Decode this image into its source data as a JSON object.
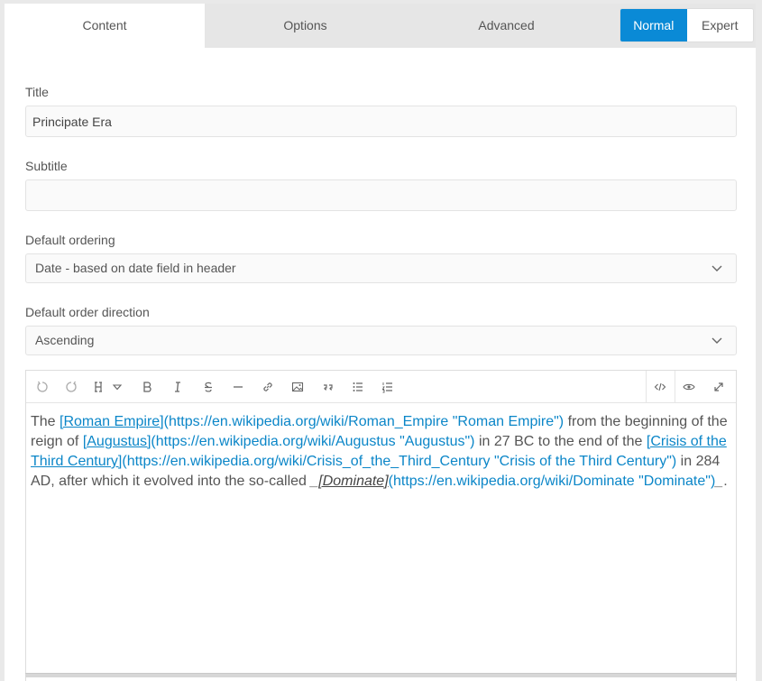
{
  "tabs": [
    {
      "label": "Content"
    },
    {
      "label": "Options"
    },
    {
      "label": "Advanced"
    }
  ],
  "mode": {
    "normal": "Normal",
    "expert": "Expert"
  },
  "fields": {
    "title": {
      "label": "Title",
      "value": "Principate Era"
    },
    "subtitle": {
      "label": "Subtitle",
      "value": ""
    },
    "ordering": {
      "label": "Default ordering",
      "value": "Date - based on date field in header"
    },
    "direction": {
      "label": "Default order direction",
      "value": "Ascending"
    }
  },
  "editor": {
    "toolbar": [
      "undo-icon",
      "redo-icon",
      "heading-icon",
      "bold-icon",
      "italic-icon",
      "strikethrough-icon",
      "horizontal-rule-icon",
      "link-icon",
      "image-icon",
      "quote-icon",
      "bullet-list-icon",
      "numbered-list-icon",
      "code-view-icon",
      "preview-icon",
      "fullscreen-icon"
    ],
    "text": {
      "s1": "The ",
      "l1_text": "[Roman Empire]",
      "l1_url": "(https://en.wikipedia.org/wiki/Roman_Empire \"Roman Empire\")",
      "s2": " from the beginning of the reign of ",
      "l2_text": "[Augustus]",
      "l2_url": "(https://en.wikipedia.org/wiki/Augustus \"Augustus\")",
      "s3": " in 27 BC to the end of the ",
      "l3_text": "[Crisis of the Third Century]",
      "l3_url": "(https://en.wikipedia.org/wiki/Crisis_of_the_Third_Century \"Crisis of the Third Century\")",
      "s4": " in 284 AD, after which it evolved into the so-called ",
      "em_open": "_",
      "l4_text": "[Dominate]",
      "l4_url": "(https://en.wikipedia.org/wiki/Dominate \"Dominate\")",
      "em_close": "_",
      "s5": "."
    }
  },
  "colors": {
    "accent": "#0a8ad6",
    "link": "#0b86c8"
  }
}
